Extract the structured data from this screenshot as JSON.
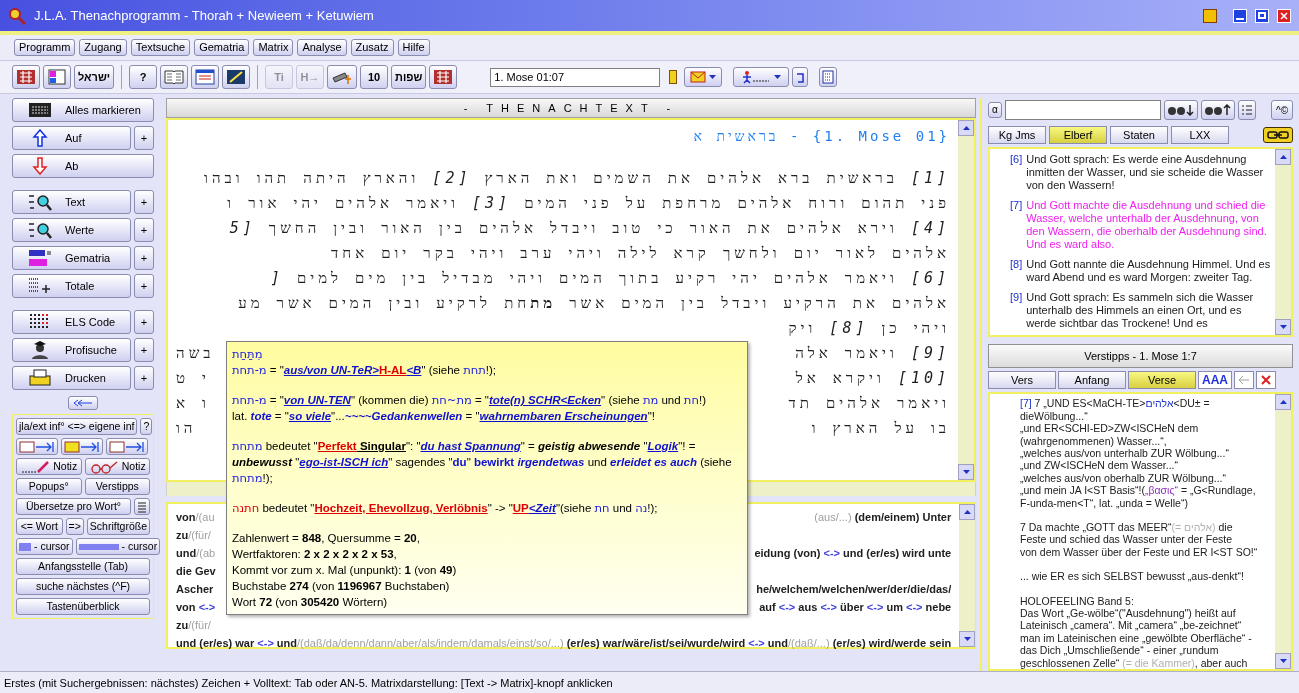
{
  "window": {
    "title": "J.L.A. Thenachprogramm - Thorah + Newieem + Ketuwiem"
  },
  "menu": [
    "Programm",
    "Zugang",
    "Textsuche",
    "Gematria",
    "Matrix",
    "Analyse",
    "Zusatz",
    "Hilfe"
  ],
  "toolbar": {
    "items": [
      {
        "kind": "grid",
        "disabled": false
      },
      {
        "kind": "panel",
        "disabled": false
      },
      {
        "kind": "text",
        "text": "ישראל",
        "disabled": false
      },
      {
        "kind": "sep"
      },
      {
        "kind": "text",
        "text": "?",
        "disabled": false
      },
      {
        "kind": "book",
        "disabled": false
      },
      {
        "kind": "window",
        "disabled": false
      },
      {
        "kind": "slash",
        "disabled": false
      },
      {
        "kind": "sep"
      },
      {
        "kind": "text",
        "text": "Ti",
        "disabled": true
      },
      {
        "kind": "text",
        "text": "H→",
        "disabled": true
      },
      {
        "kind": "telescope",
        "disabled": false
      },
      {
        "kind": "text",
        "text": "10",
        "disabled": false
      },
      {
        "kind": "text",
        "text": "שפות",
        "disabled": false
      },
      {
        "kind": "grid",
        "disabled": false
      }
    ],
    "location": "1. Mose 01:07"
  },
  "sidebar": {
    "items": [
      {
        "kind": "select-all",
        "label": "Alles markieren"
      },
      {
        "kind": "up",
        "label": "Auf",
        "plus": "+"
      },
      {
        "kind": "down",
        "label": "Ab"
      },
      {
        "kind": "text",
        "label": "Text",
        "plus": "+"
      },
      {
        "kind": "values",
        "label": "Werte",
        "plus": "+"
      },
      {
        "kind": "gematria",
        "label": "Gematria",
        "plus": "+"
      },
      {
        "kind": "totals",
        "label": "Totale",
        "plus": "+"
      },
      {
        "kind": "els",
        "label": "ELS Code",
        "plus": "+"
      },
      {
        "kind": "profi",
        "label": "Profisuche",
        "plus": "+"
      },
      {
        "kind": "print",
        "label": "Drucken",
        "plus": "+"
      }
    ],
    "tools": [
      [
        {
          "kind": "text",
          "label": "jla/ext inf° <=> eigene inf"
        },
        {
          "kind": "text",
          "label": "?"
        }
      ],
      [
        {
          "kind": "book-arrow"
        },
        {
          "kind": "bar-arrow"
        },
        {
          "kind": "num-arrow"
        }
      ],
      [
        {
          "kind": "pen",
          "label": "Notiz"
        },
        {
          "kind": "glasses",
          "label": "Notiz"
        }
      ],
      [
        {
          "kind": "text",
          "label": "Popups°"
        },
        {
          "kind": "text",
          "label": "Verstipps"
        }
      ],
      [
        {
          "kind": "text",
          "label": "Übersetze pro Wort°"
        },
        {
          "kind": "list"
        }
      ],
      [
        {
          "kind": "text",
          "label": "<= Wort"
        },
        {
          "kind": "text",
          "label": "=>"
        },
        {
          "kind": "text",
          "label": "Schriftgröße"
        }
      ],
      [
        {
          "kind": "small-bar",
          "label": "- cursor"
        },
        {
          "kind": "wide-bar",
          "label": "- cursor"
        }
      ],
      [
        {
          "kind": "text",
          "label": "Anfangsstelle (Tab)"
        }
      ],
      [
        {
          "kind": "text",
          "label": "suche nächstes (^F)"
        }
      ],
      [
        {
          "kind": "text",
          "label": "Tastenüberblick"
        }
      ]
    ]
  },
  "text_panel": {
    "header": "- THENACHTEXT -",
    "heading": "בראשית א - {1. Mose 01}",
    "lines": [
      {
        "text": "*[1]* בראשית ברא אלהים את השמים ואת הארץ *[2]* והארץ היתה תהו ובהו"
      },
      {
        "text": "פני תהום ורוח אלהים מרחפת על פני המים *[3]* ויאמר אלהים יהי אור ו"
      },
      {
        "text": "*[4]* וירא אלהים את האור כי טוב ויבדל אלהים בין האור ובין החשך *[5*"
      },
      {
        "text": "אלהים לאור יום ולחשך קרא לילה ויהי ערב ויהי בקר יום אחד"
      },
      {
        "text": "*[6]* ויאמר אלהים יהי רקיע בתוך המים ויהי מבדיל בין מים למים *[*"
      },
      {
        "text": "אלהים את הרקיע ויבדל בין המים אשר **מת**חת לרקיע ובין המים אשר מע"
      },
      {
        "right": "ויהי כן *[8]* ויק"
      },
      {
        "right": "*[9]* ויאמר אלה",
        "left": "בשה"
      },
      {
        "right": "*[10]* ויקרא אל",
        "left": "י ט"
      },
      {
        "right": "ויאמר אלהים תד",
        "left": "ו א"
      },
      {
        "right": "בו על הארץ ו",
        "left": "הו"
      }
    ]
  },
  "translation": {
    "lines": [
      {
        "left": [
          {
            "kind": "p",
            "text": "von"
          },
          {
            "kind": "g",
            "text": "/(au"
          }
        ],
        "right": [
          {
            "kind": "g",
            "text": "(aus/...)"
          },
          {
            "kind": "p",
            "text": " (dem/einem) Unter"
          }
        ]
      },
      {
        "left": [
          {
            "kind": "p",
            "text": "zu"
          },
          {
            "kind": "g",
            "text": "/(für/"
          }
        ]
      },
      {
        "left": [
          {
            "kind": "p",
            "text": "und"
          },
          {
            "kind": "g",
            "text": "/(ab"
          }
        ],
        "right": [
          {
            "kind": "p",
            "text": "eidung (von) "
          },
          {
            "kind": "a",
            "text": "<->"
          },
          {
            "kind": "p",
            "text": " und (er/es) wird unte"
          }
        ]
      },
      {
        "left": [
          {
            "kind": "p",
            "text": "die Gev"
          }
        ]
      },
      {
        "left": [
          {
            "kind": "p",
            "text": "Ascher"
          }
        ],
        "right": [
          {
            "kind": "p",
            "text": "he/welchem/welchen/wer/der/die/das/"
          }
        ]
      },
      {
        "left": [
          {
            "kind": "p",
            "text": "von "
          },
          {
            "kind": "a",
            "text": "<->"
          }
        ],
        "right": [
          {
            "kind": "p",
            "text": "auf "
          },
          {
            "kind": "a",
            "text": "<->"
          },
          {
            "kind": "p",
            "text": " aus "
          },
          {
            "kind": "a",
            "text": "<->"
          },
          {
            "kind": "p",
            "text": " über "
          },
          {
            "kind": "a",
            "text": "<->"
          },
          {
            "kind": "p",
            "text": " um "
          },
          {
            "kind": "a",
            "text": "<->"
          },
          {
            "kind": "p",
            "text": " nebe"
          }
        ]
      },
      {
        "left": [
          {
            "kind": "p",
            "text": "zu"
          },
          {
            "kind": "g",
            "text": "/(für/"
          }
        ]
      },
      {
        "full": [
          {
            "kind": "p",
            "text": "und (er/es) war "
          },
          {
            "kind": "a",
            "text": "<->"
          },
          {
            "kind": "p",
            "text": " und"
          },
          {
            "kind": "g",
            "text": "/(daß/da/denn/dann/aber/als/indem/damals/einst/so/...)"
          },
          {
            "kind": "p",
            "text": " (er/es) war/wäre/ist/sei/wurde/wird "
          },
          {
            "kind": "a",
            "text": "<->"
          },
          {
            "kind": "p",
            "text": " und"
          },
          {
            "kind": "g",
            "text": "/(daß/...)"
          },
          {
            "kind": "p",
            "text": " (er/es) wird/werde sein"
          }
        ]
      }
    ]
  },
  "popup": {
    "paragraphs": [
      [
        [
          {
            "kind": "h",
            "text": "מִתַּחַת"
          }
        ],
        [
          {
            "kind": "h",
            "text": "מ-תחת"
          },
          {
            "kind": "p",
            "text": " = \""
          },
          {
            "kind": "l",
            "text": "aus/von UN-TeR>"
          },
          {
            "kind": "lr",
            "text": "H-AL"
          },
          {
            "kind": "l",
            "text": "<B"
          },
          {
            "kind": "p",
            "text": "\" (siehe "
          },
          {
            "kind": "h",
            "text": "תחת"
          },
          {
            "kind": "p",
            "text": "!);"
          }
        ]
      ],
      [
        [
          {
            "kind": "h",
            "text": "מ-תחת"
          },
          {
            "kind": "p",
            "text": " = \""
          },
          {
            "kind": "l",
            "text": "von UN-TEN"
          },
          {
            "kind": "p",
            "text": "\" (kommen die) "
          },
          {
            "kind": "h",
            "text": "מת~חת"
          },
          {
            "kind": "p",
            "text": " = \""
          },
          {
            "kind": "l",
            "text": "tote(n) SCHR<Ecken"
          },
          {
            "kind": "p",
            "text": "\" (siehe "
          },
          {
            "kind": "h",
            "text": "מת"
          },
          {
            "kind": "p",
            "text": " und "
          },
          {
            "kind": "h",
            "text": "חת"
          },
          {
            "kind": "p",
            "text": "!)"
          }
        ],
        [
          {
            "kind": "p",
            "text": "lat. "
          },
          {
            "kind": "eb",
            "text": "tote"
          },
          {
            "kind": "p",
            "text": " = \""
          },
          {
            "kind": "l",
            "text": "so viele"
          },
          {
            "kind": "p",
            "text": "\"..."
          },
          {
            "kind": "eb",
            "text": "~~~~Gedankenwellen"
          },
          {
            "kind": "p",
            "text": " = \""
          },
          {
            "kind": "l",
            "text": "wahrnembaren Erscheinungen"
          },
          {
            "kind": "p",
            "text": "\"!"
          }
        ]
      ],
      [
        [
          {
            "kind": "h",
            "text": "מתחת"
          },
          {
            "kind": "p",
            "text": " bedeutet \""
          },
          {
            "kind": "lr",
            "text": "Perfekt"
          },
          {
            "kind": "u",
            "text": " Singular"
          },
          {
            "kind": "p",
            "text": "\": \""
          },
          {
            "kind": "l",
            "text": "du hast Spannung"
          },
          {
            "kind": "p",
            "text": "\" = "
          },
          {
            "kind": "e",
            "text": "geistig abwesende"
          },
          {
            "kind": "p",
            "text": " \""
          },
          {
            "kind": "l",
            "text": "Logik"
          },
          {
            "kind": "p",
            "text": "\"! = "
          },
          {
            "kind": "e",
            "text": "unbewusst"
          },
          {
            "kind": "p",
            "text": " \""
          },
          {
            "kind": "l",
            "text": "ego-ist-ISCH ich"
          },
          {
            "kind": "p",
            "text": "\" sagendes \""
          },
          {
            "kind": "bb",
            "text": "du"
          },
          {
            "kind": "p",
            "text": "\" "
          },
          {
            "kind": "bb",
            "text": "bewirkt"
          },
          {
            "kind": "eb",
            "text": " irgendetwas"
          },
          {
            "kind": "p",
            "text": " und "
          },
          {
            "kind": "eb",
            "text": "erleidet es auch"
          },
          {
            "kind": "p",
            "text": " (siehe "
          },
          {
            "kind": "h",
            "text": "מתחת"
          },
          {
            "kind": "p",
            "text": "!);"
          }
        ]
      ],
      [
        [
          {
            "kind": "hr",
            "text": "חתנה"
          },
          {
            "kind": "p",
            "text": " bedeutet \""
          },
          {
            "kind": "lr",
            "text": "Hochzeit, Ehevollzug, Verlöbnis"
          },
          {
            "kind": "p",
            "text": "\" -> \""
          },
          {
            "kind": "lr",
            "text": "UP"
          },
          {
            "kind": "l",
            "text": "<Zeit"
          },
          {
            "kind": "p",
            "text": "\"(siehe "
          },
          {
            "kind": "h",
            "text": "חת"
          },
          {
            "kind": "p",
            "text": " und "
          },
          {
            "kind": "h",
            "text": "נה"
          },
          {
            "kind": "p",
            "text": "!);"
          }
        ]
      ],
      [
        [
          {
            "kind": "p",
            "text": "Zahlenwert = "
          },
          {
            "kind": "b",
            "text": "848"
          },
          {
            "kind": "p",
            "text": ", Quersumme = "
          },
          {
            "kind": "b",
            "text": "20"
          },
          {
            "kind": "p",
            "text": ","
          }
        ],
        [
          {
            "kind": "p",
            "text": "Wertfaktoren: "
          },
          {
            "kind": "b",
            "text": "2 x 2 x 2 x 2 x 53"
          },
          {
            "kind": "p",
            "text": ","
          }
        ],
        [
          {
            "kind": "p",
            "text": "Kommt vor zum x. Mal (unpunkt): "
          },
          {
            "kind": "b",
            "text": "1"
          },
          {
            "kind": "p",
            "text": " (von "
          },
          {
            "kind": "b",
            "text": "49"
          },
          {
            "kind": "p",
            "text": ")"
          }
        ],
        [
          {
            "kind": "p",
            "text": "Buchstabe "
          },
          {
            "kind": "b",
            "text": "274"
          },
          {
            "kind": "p",
            "text": " (von "
          },
          {
            "kind": "b",
            "text": "1196967"
          },
          {
            "kind": "p",
            "text": " Buchstaben)"
          }
        ],
        [
          {
            "kind": "p",
            "text": "Wort "
          },
          {
            "kind": "b",
            "text": "72"
          },
          {
            "kind": "p",
            "text": " (von "
          },
          {
            "kind": "b",
            "text": "305420"
          },
          {
            "kind": "p",
            "text": " Wörtern)"
          }
        ]
      ]
    ]
  },
  "right_panel": {
    "search_prefix": "α",
    "copy_button": "^©",
    "translations": [
      {
        "label": "Kg Jms",
        "selected": false
      },
      {
        "label": "Elberf",
        "selected": true
      },
      {
        "label": "Staten",
        "selected": false
      },
      {
        "label": "LXX",
        "selected": false
      }
    ],
    "verses": [
      {
        "number": "[6]",
        "text": "Und Gott sprach: Es werde eine Ausdehnung inmitten der Wasser, und sie scheide die Wasser von den Wassern!",
        "selected": false
      },
      {
        "number": "[7]",
        "text": "Und Gott machte die Ausdehnung und schied die Wasser, welche unterhalb der Ausdehnung, von den Wassern, die oberhalb der Ausdehnung sind. Und es ward also.",
        "selected": true
      },
      {
        "number": "[8]",
        "text": "Und Gott nannte die Ausdehnung Himmel. Und es ward Abend und es ward Morgen: zweiter Tag.",
        "selected": false
      },
      {
        "number": "[9]",
        "text": "Und Gott sprach: Es sammeln sich die Wasser unterhalb des Himmels an einen Ort, und es werde sichtbar das Trockene! Und es",
        "selected": false
      }
    ],
    "tips_title": "Verstipps - 1. Mose 1:7",
    "tip_tabs": [
      {
        "label": "Vers",
        "selected": false
      },
      {
        "label": "Anfang",
        "selected": false
      },
      {
        "label": "Verse",
        "selected": true
      }
    ],
    "font_button": "AAA",
    "tips": [
      [
        [
          {
            "kind": "v",
            "text": "[7]"
          },
          {
            "kind": "p",
            "text": " 7 „UND ES<MaCH-TE>"
          },
          {
            "kind": "h",
            "text": "אלהים"
          },
          {
            "kind": "p",
            "text": "<DU± ="
          }
        ],
        [
          {
            "kind": "p",
            "text": "dieWölbung...“"
          }
        ],
        [
          {
            "kind": "p",
            "text": "„und ER<SCHI-ED>ZW<ISCHeN dem"
          }
        ],
        [
          {
            "kind": "p",
            "text": "(wahrgenommenen) Wasser...“,"
          }
        ],
        [
          {
            "kind": "p",
            "text": "„welches aus/von unterhalb ZUR Wölbung...“"
          }
        ],
        [
          {
            "kind": "p",
            "text": "„und ZW<ISCHeN dem Wasser...“"
          }
        ],
        [
          {
            "kind": "p",
            "text": "„welches aus/von oberhalb ZUR Wölbung...“"
          }
        ],
        [
          {
            "kind": "p",
            "text": "„und mein JA I<ST Basis“!("
          },
          {
            "kind": "gr",
            "text": "„βασις“"
          },
          {
            "kind": "p",
            "text": " = „G<Rundlage,"
          }
        ],
        [
          {
            "kind": "p",
            "text": "F-unda-men<T“, lat. „unda = Welle“)"
          }
        ]
      ],
      [
        [
          {
            "kind": "p",
            "text": "7  Da machte „GOTT das MEER“"
          },
          {
            "kind": "g",
            "text": "(= אלהים)"
          },
          {
            "kind": "p",
            "text": " die"
          }
        ],
        [
          {
            "kind": "p",
            "text": "Feste und schied das Wasser unter der Feste"
          }
        ],
        [
          {
            "kind": "p",
            "text": "von dem Wasser über der Feste und ER I<ST SO!“"
          }
        ]
      ],
      [
        [
          {
            "kind": "p",
            "text": "... wie ER es sich SELBST bewusst „aus-denkt“!"
          }
        ]
      ],
      [
        [
          {
            "kind": "p",
            "text": "HOLOFEELING Band 5:"
          }
        ],
        [
          {
            "kind": "p",
            "text": "Das Wort „Ge-wölbe“(\"Ausdehnung\") heißt auf"
          }
        ],
        [
          {
            "kind": "p",
            "text": "Lateinisch „camera“. Mit „camera“ „be-zeichnet“"
          }
        ],
        [
          {
            "kind": "p",
            "text": "man im Lateinischen eine „gewölbte Oberfläche“ -"
          }
        ],
        [
          {
            "kind": "p",
            "text": "das Dich „Umschließende“ - einer „rundum"
          }
        ],
        [
          {
            "kind": "p",
            "text": "geschlossenen Zelle“ "
          },
          {
            "kind": "g",
            "text": "(= die Kammer)"
          },
          {
            "kind": "p",
            "text": ", aber auch"
          }
        ]
      ]
    ]
  },
  "status_bar": "Erstes (mit Suchergebnissen: nächstes) Zeichen + Volltext: Tab oder AN-5. Matrixdarstellung: [Text -> Matrix]-knopf anklicken"
}
